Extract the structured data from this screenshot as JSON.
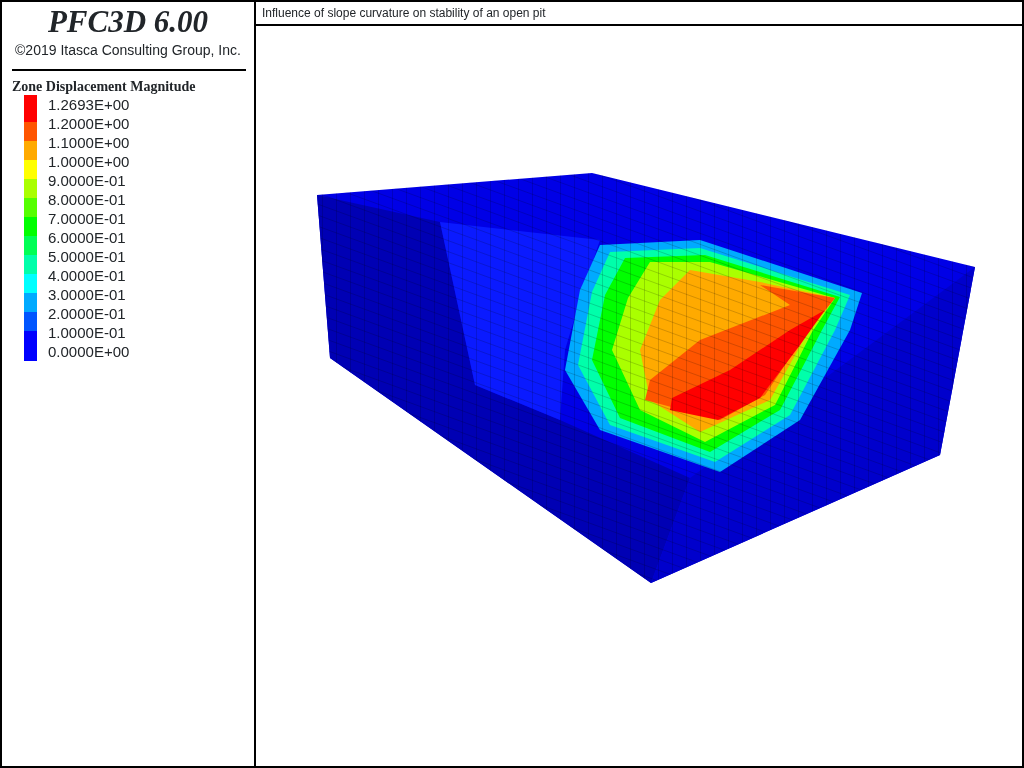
{
  "header": {
    "product": "PFC3D 6.00",
    "copyright": "©2019 Itasca Consulting Group, Inc."
  },
  "legend": {
    "title": "Zone Displacement Magnitude",
    "labels": [
      "1.2693E+00",
      "1.2000E+00",
      "1.1000E+00",
      "1.0000E+00",
      "9.0000E-01",
      "8.0000E-01",
      "7.0000E-01",
      "6.0000E-01",
      "5.0000E-01",
      "4.0000E-01",
      "3.0000E-01",
      "2.0000E-01",
      "1.0000E-01",
      "0.0000E+00"
    ],
    "bands": [
      {
        "color": "#ff0000"
      },
      {
        "color": "#ff5500"
      },
      {
        "color": "#ffaa00"
      },
      {
        "color": "#ffff00"
      },
      {
        "color": "#aaff00"
      },
      {
        "color": "#55ff00"
      },
      {
        "color": "#00ff00"
      },
      {
        "color": "#00ff55"
      },
      {
        "color": "#00ffaa"
      },
      {
        "color": "#00ffff"
      },
      {
        "color": "#00aaff"
      },
      {
        "color": "#0055ff"
      },
      {
        "color": "#0000ff"
      }
    ]
  },
  "plot": {
    "title": "Influence of slope curvature on stability of an open pit"
  }
}
